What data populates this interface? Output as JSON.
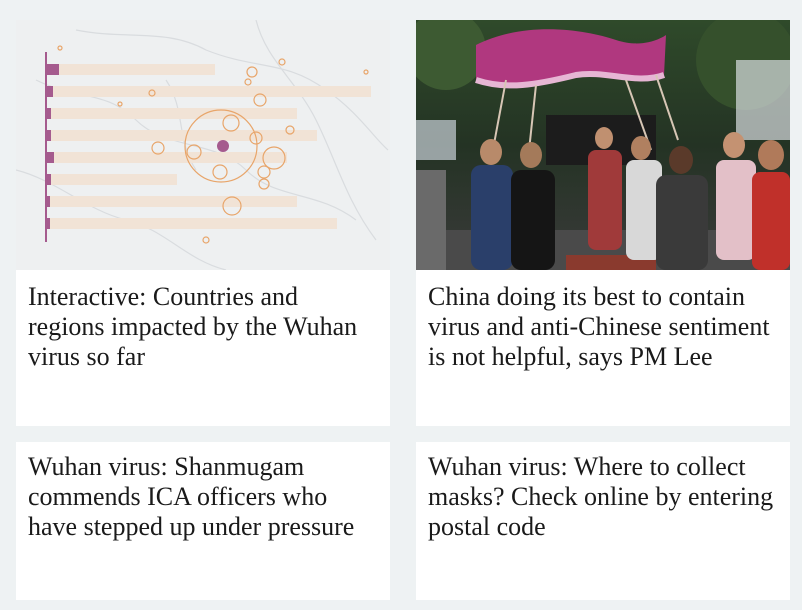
{
  "articles": [
    {
      "title": "Interactive: Countries and regions impacted by the Wuhan virus so far",
      "thumbnail": "infographic-map-chart-icon"
    },
    {
      "title": "China doing its best to contain virus and anti-Chinese sentiment is not helpful, says PM Lee",
      "thumbnail": "dragon-dance-photo"
    },
    {
      "title": "Wuhan virus: Shanmugam commends ICA officers who have stepped up under pressure"
    },
    {
      "title": "Wuhan virus: Where to collect masks? Check online by entering postal code"
    }
  ],
  "colors": {
    "page_bg": "#eef2f3",
    "card_bg": "#ffffff",
    "bar": "#f1e3d6",
    "bar_accent": "#a55b8e",
    "bubble": "#e8a56a"
  }
}
